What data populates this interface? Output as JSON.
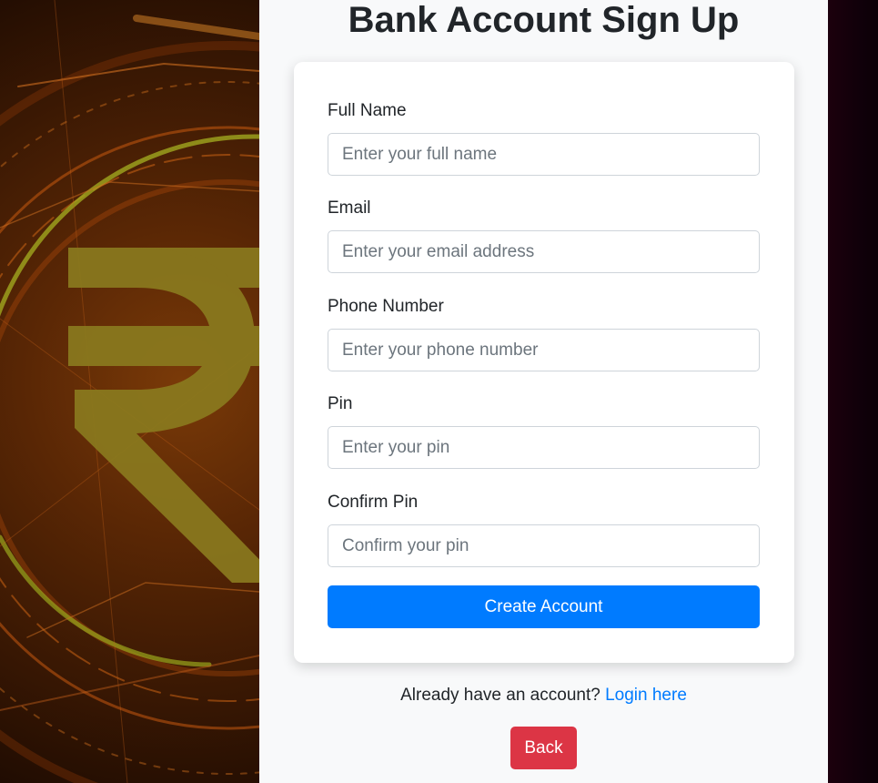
{
  "page": {
    "title": "Bank Account Sign Up"
  },
  "form": {
    "fields": [
      {
        "label": "Full Name",
        "placeholder": "Enter your full name",
        "value": ""
      },
      {
        "label": "Email",
        "placeholder": "Enter your email address",
        "value": ""
      },
      {
        "label": "Phone Number",
        "placeholder": "Enter your phone number",
        "value": ""
      },
      {
        "label": "Pin",
        "placeholder": "Enter your pin",
        "value": ""
      },
      {
        "label": "Confirm Pin",
        "placeholder": "Confirm your pin",
        "value": ""
      }
    ],
    "submit_label": "Create Account"
  },
  "footer": {
    "login_prompt": "Already have an account?",
    "login_link": "Login here",
    "back_label": "Back"
  },
  "decor": {
    "left_panel_icon": "rupee-icon"
  },
  "colors": {
    "primary": "#007bff",
    "danger": "#dc3545",
    "background": "#f8f9fa",
    "left_accent": "#8a7a1e"
  }
}
